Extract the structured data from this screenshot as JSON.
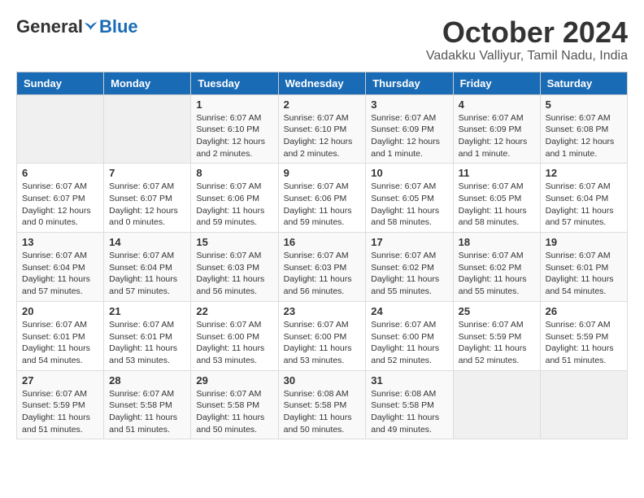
{
  "logo": {
    "general": "General",
    "blue": "Blue"
  },
  "title": {
    "month": "October 2024",
    "location": "Vadakku Valliyur, Tamil Nadu, India"
  },
  "weekdays": [
    "Sunday",
    "Monday",
    "Tuesday",
    "Wednesday",
    "Thursday",
    "Friday",
    "Saturday"
  ],
  "weeks": [
    [
      null,
      null,
      {
        "day": "1",
        "sunrise": "Sunrise: 6:07 AM",
        "sunset": "Sunset: 6:10 PM",
        "daylight": "Daylight: 12 hours and 2 minutes."
      },
      {
        "day": "2",
        "sunrise": "Sunrise: 6:07 AM",
        "sunset": "Sunset: 6:10 PM",
        "daylight": "Daylight: 12 hours and 2 minutes."
      },
      {
        "day": "3",
        "sunrise": "Sunrise: 6:07 AM",
        "sunset": "Sunset: 6:09 PM",
        "daylight": "Daylight: 12 hours and 1 minute."
      },
      {
        "day": "4",
        "sunrise": "Sunrise: 6:07 AM",
        "sunset": "Sunset: 6:09 PM",
        "daylight": "Daylight: 12 hours and 1 minute."
      },
      {
        "day": "5",
        "sunrise": "Sunrise: 6:07 AM",
        "sunset": "Sunset: 6:08 PM",
        "daylight": "Daylight: 12 hours and 1 minute."
      }
    ],
    [
      {
        "day": "6",
        "sunrise": "Sunrise: 6:07 AM",
        "sunset": "Sunset: 6:07 PM",
        "daylight": "Daylight: 12 hours and 0 minutes."
      },
      {
        "day": "7",
        "sunrise": "Sunrise: 6:07 AM",
        "sunset": "Sunset: 6:07 PM",
        "daylight": "Daylight: 12 hours and 0 minutes."
      },
      {
        "day": "8",
        "sunrise": "Sunrise: 6:07 AM",
        "sunset": "Sunset: 6:06 PM",
        "daylight": "Daylight: 11 hours and 59 minutes."
      },
      {
        "day": "9",
        "sunrise": "Sunrise: 6:07 AM",
        "sunset": "Sunset: 6:06 PM",
        "daylight": "Daylight: 11 hours and 59 minutes."
      },
      {
        "day": "10",
        "sunrise": "Sunrise: 6:07 AM",
        "sunset": "Sunset: 6:05 PM",
        "daylight": "Daylight: 11 hours and 58 minutes."
      },
      {
        "day": "11",
        "sunrise": "Sunrise: 6:07 AM",
        "sunset": "Sunset: 6:05 PM",
        "daylight": "Daylight: 11 hours and 58 minutes."
      },
      {
        "day": "12",
        "sunrise": "Sunrise: 6:07 AM",
        "sunset": "Sunset: 6:04 PM",
        "daylight": "Daylight: 11 hours and 57 minutes."
      }
    ],
    [
      {
        "day": "13",
        "sunrise": "Sunrise: 6:07 AM",
        "sunset": "Sunset: 6:04 PM",
        "daylight": "Daylight: 11 hours and 57 minutes."
      },
      {
        "day": "14",
        "sunrise": "Sunrise: 6:07 AM",
        "sunset": "Sunset: 6:04 PM",
        "daylight": "Daylight: 11 hours and 57 minutes."
      },
      {
        "day": "15",
        "sunrise": "Sunrise: 6:07 AM",
        "sunset": "Sunset: 6:03 PM",
        "daylight": "Daylight: 11 hours and 56 minutes."
      },
      {
        "day": "16",
        "sunrise": "Sunrise: 6:07 AM",
        "sunset": "Sunset: 6:03 PM",
        "daylight": "Daylight: 11 hours and 56 minutes."
      },
      {
        "day": "17",
        "sunrise": "Sunrise: 6:07 AM",
        "sunset": "Sunset: 6:02 PM",
        "daylight": "Daylight: 11 hours and 55 minutes."
      },
      {
        "day": "18",
        "sunrise": "Sunrise: 6:07 AM",
        "sunset": "Sunset: 6:02 PM",
        "daylight": "Daylight: 11 hours and 55 minutes."
      },
      {
        "day": "19",
        "sunrise": "Sunrise: 6:07 AM",
        "sunset": "Sunset: 6:01 PM",
        "daylight": "Daylight: 11 hours and 54 minutes."
      }
    ],
    [
      {
        "day": "20",
        "sunrise": "Sunrise: 6:07 AM",
        "sunset": "Sunset: 6:01 PM",
        "daylight": "Daylight: 11 hours and 54 minutes."
      },
      {
        "day": "21",
        "sunrise": "Sunrise: 6:07 AM",
        "sunset": "Sunset: 6:01 PM",
        "daylight": "Daylight: 11 hours and 53 minutes."
      },
      {
        "day": "22",
        "sunrise": "Sunrise: 6:07 AM",
        "sunset": "Sunset: 6:00 PM",
        "daylight": "Daylight: 11 hours and 53 minutes."
      },
      {
        "day": "23",
        "sunrise": "Sunrise: 6:07 AM",
        "sunset": "Sunset: 6:00 PM",
        "daylight": "Daylight: 11 hours and 53 minutes."
      },
      {
        "day": "24",
        "sunrise": "Sunrise: 6:07 AM",
        "sunset": "Sunset: 6:00 PM",
        "daylight": "Daylight: 11 hours and 52 minutes."
      },
      {
        "day": "25",
        "sunrise": "Sunrise: 6:07 AM",
        "sunset": "Sunset: 5:59 PM",
        "daylight": "Daylight: 11 hours and 52 minutes."
      },
      {
        "day": "26",
        "sunrise": "Sunrise: 6:07 AM",
        "sunset": "Sunset: 5:59 PM",
        "daylight": "Daylight: 11 hours and 51 minutes."
      }
    ],
    [
      {
        "day": "27",
        "sunrise": "Sunrise: 6:07 AM",
        "sunset": "Sunset: 5:59 PM",
        "daylight": "Daylight: 11 hours and 51 minutes."
      },
      {
        "day": "28",
        "sunrise": "Sunrise: 6:07 AM",
        "sunset": "Sunset: 5:58 PM",
        "daylight": "Daylight: 11 hours and 51 minutes."
      },
      {
        "day": "29",
        "sunrise": "Sunrise: 6:07 AM",
        "sunset": "Sunset: 5:58 PM",
        "daylight": "Daylight: 11 hours and 50 minutes."
      },
      {
        "day": "30",
        "sunrise": "Sunrise: 6:08 AM",
        "sunset": "Sunset: 5:58 PM",
        "daylight": "Daylight: 11 hours and 50 minutes."
      },
      {
        "day": "31",
        "sunrise": "Sunrise: 6:08 AM",
        "sunset": "Sunset: 5:58 PM",
        "daylight": "Daylight: 11 hours and 49 minutes."
      },
      null,
      null
    ]
  ]
}
